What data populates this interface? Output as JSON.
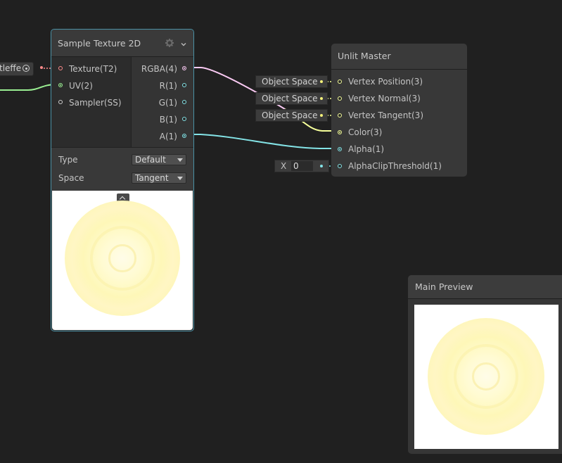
{
  "sample_texture_node": {
    "title": "Sample Texture 2D",
    "inputs": [
      "Texture(T2)",
      "UV(2)",
      "Sampler(SS)"
    ],
    "outputs": [
      "RGBA(4)",
      "R(1)",
      "G(1)",
      "B(1)",
      "A(1)"
    ],
    "type_label": "Type",
    "type_value": "Default",
    "space_label": "Space",
    "space_value": "Tangent"
  },
  "texture_property_pill": {
    "label": "tleffe"
  },
  "unlit_master_node": {
    "title": "Unlit Master",
    "inputs": [
      "Vertex Position(3)",
      "Vertex Normal(3)",
      "Vertex Tangent(3)",
      "Color(3)",
      "Alpha(1)",
      "AlphaClipThreshold(1)"
    ],
    "object_space_fields": [
      "Object Space",
      "Object Space",
      "Object Space"
    ],
    "alpha_clip_x_label": "X",
    "alpha_clip_value": "0"
  },
  "main_preview": {
    "title": "Main Preview"
  },
  "colors": {
    "background": "#202020",
    "selected_outline": "#4a90a4",
    "wire_vector1": "#84e4e7",
    "wire_vector4": "#fbcbf4",
    "wire_vector3": "#f6ff9a",
    "wire_vector2": "#9aef92",
    "port_texture": "#ff8b8b"
  }
}
